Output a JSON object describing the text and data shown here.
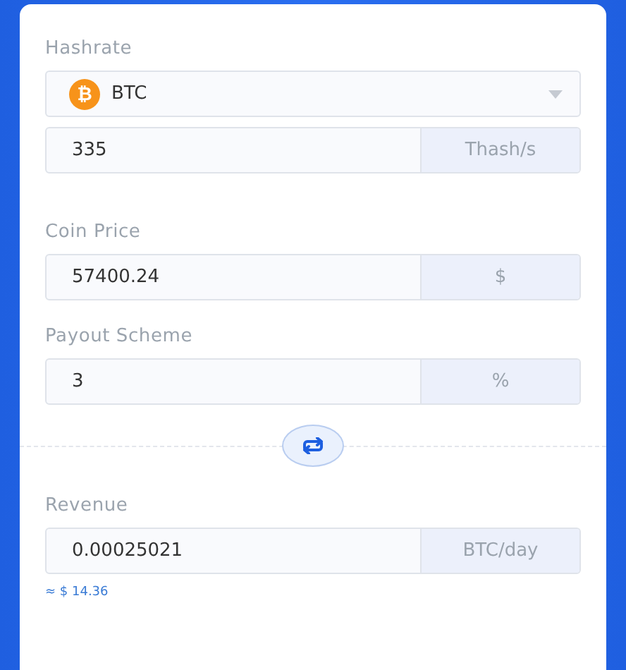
{
  "hashrate": {
    "label": "Hashrate",
    "coin": {
      "symbol": "₿",
      "name": "BTC"
    },
    "value": "335",
    "unit": "Thash/s"
  },
  "coin_price": {
    "label": "Coin Price",
    "value": "57400.24",
    "unit": "$"
  },
  "payout_scheme": {
    "label": "Payout Scheme",
    "value": "3",
    "unit": "%"
  },
  "revenue": {
    "label": "Revenue",
    "value": "0.00025021",
    "unit": "BTC/day",
    "approx": "≈ $ 14.36"
  }
}
